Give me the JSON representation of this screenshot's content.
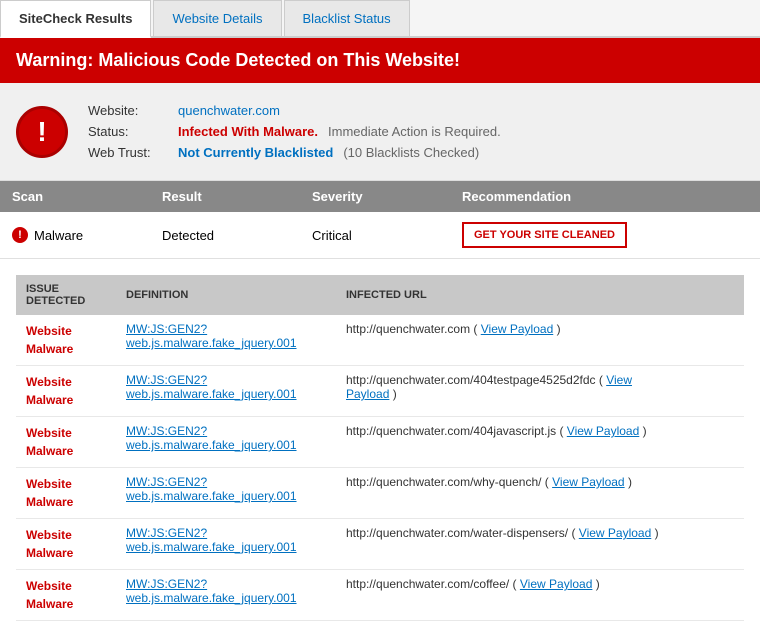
{
  "tabs": [
    {
      "label": "SiteCheck Results",
      "state": "active"
    },
    {
      "label": "Website Details",
      "state": "inactive"
    },
    {
      "label": "Blacklist Status",
      "state": "inactive"
    }
  ],
  "warning_banner": "Warning: Malicious Code Detected on This Website!",
  "site_info": {
    "website_label": "Website:",
    "website_value": "quenchwater.com",
    "status_label": "Status:",
    "status_value_red": "Infected With Malware.",
    "status_value_gray": " Immediate Action is Required.",
    "webtrust_label": "Web Trust:",
    "webtrust_value_blue": "Not Currently Blacklisted",
    "webtrust_value_paren": " (10 Blacklists Checked)"
  },
  "scan_table": {
    "headers": [
      "Scan",
      "Result",
      "Severity",
      "Recommendation"
    ],
    "rows": [
      {
        "scan": "Malware",
        "result": "Detected",
        "severity": "Critical",
        "recommendation": "GET YOUR SITE CLEANED"
      }
    ]
  },
  "issues_table": {
    "headers": [
      "ISSUE\nDETECTED",
      "DEFINITION",
      "INFECTED URL"
    ],
    "header_issue": "ISSUE DETECTED",
    "header_def": "DEFINITION",
    "header_url": "INFECTED URL",
    "rows": [
      {
        "issue": "Website Malware",
        "definition": "MW:JS:GEN2? web.js.malware.fake_jquery.001",
        "url": "http://quenchwater.com",
        "url_extra": "( View Payload )"
      },
      {
        "issue": "Website Malware",
        "definition": "MW:JS:GEN2? web.js.malware.fake_jquery.001",
        "url": "http://quenchwater.com/404testpage4525d2fdc",
        "url_extra": "( View Payload )"
      },
      {
        "issue": "Website Malware",
        "definition": "MW:JS:GEN2? web.js.malware.fake_jquery.001",
        "url": "http://quenchwater.com/404javascript.js",
        "url_extra": "( View Payload )"
      },
      {
        "issue": "Website Malware",
        "definition": "MW:JS:GEN2? web.js.malware.fake_jquery.001",
        "url": "http://quenchwater.com/why-quench/",
        "url_extra": "( View Payload )"
      },
      {
        "issue": "Website Malware",
        "definition": "MW:JS:GEN2? web.js.malware.fake_jquery.001",
        "url": "http://quenchwater.com/water-dispensers/",
        "url_extra": "( View Payload )"
      },
      {
        "issue": "Website Malware",
        "definition": "MW:JS:GEN2? web.js.malware.fake_jquery.001",
        "url": "http://quenchwater.com/coffee/",
        "url_extra": "( View Payload )"
      }
    ]
  }
}
